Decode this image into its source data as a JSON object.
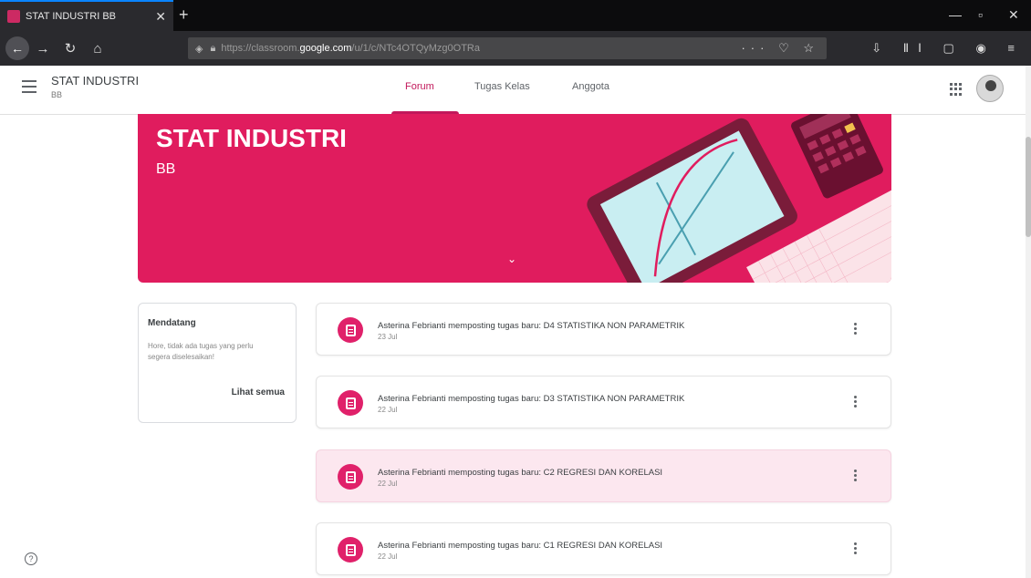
{
  "browser": {
    "tab_title": "STAT INDUSTRI BB",
    "tab_close": "✕",
    "new_tab": "+",
    "url_prefix": "https://classroom.",
    "url_host": "google.com",
    "url_path": "/u/1/c/NTc4OTQyMzg0OTRa",
    "url_actions": "··· ♡ ☆",
    "toolbar_icons": "⇩ ⅡⅠ ▢ ◉ ≡"
  },
  "header": {
    "class_name": "STAT INDUSTRI",
    "class_section": "BB",
    "tabs": [
      {
        "label": "Forum",
        "active": true
      },
      {
        "label": "Tugas Kelas",
        "active": false
      },
      {
        "label": "Anggota",
        "active": false
      }
    ]
  },
  "banner": {
    "title": "STAT INDUSTRI",
    "subtitle": "BB",
    "color": "#e01c5e"
  },
  "upcoming": {
    "title": "Mendatang",
    "text": "Hore, tidak ada tugas yang perlu segera diselesaikan!",
    "link": "Lihat semua"
  },
  "posts": [
    {
      "text": "Asterina Febrianti memposting tugas baru: D4 STATISTIKA NON PARAMETRIK",
      "date": "23 Jul"
    },
    {
      "text": "Asterina Febrianti memposting tugas baru: D3 STATISTIKA NON PARAMETRIK",
      "date": "22 Jul"
    },
    {
      "text": "Asterina Febrianti memposting tugas baru: C2 REGRESI DAN KORELASI",
      "date": "22 Jul"
    },
    {
      "text": "Asterina Febrianti memposting tugas baru: C1 REGRESI DAN KORELASI",
      "date": "22 Jul"
    }
  ],
  "help": "?"
}
